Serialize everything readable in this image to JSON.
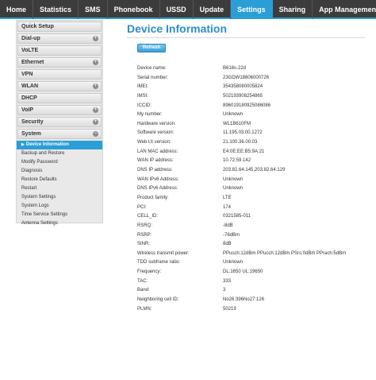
{
  "nav": {
    "tabs": [
      {
        "label": "Home"
      },
      {
        "label": "Statistics"
      },
      {
        "label": "SMS"
      },
      {
        "label": "Phonebook"
      },
      {
        "label": "USSD"
      },
      {
        "label": "Update"
      },
      {
        "label": "Settings",
        "active": true
      },
      {
        "label": "Sharing"
      },
      {
        "label": "App Management"
      }
    ]
  },
  "sidebar": {
    "items": [
      {
        "label": "Quick Setup"
      },
      {
        "label": "Dial-up"
      },
      {
        "label": "VoLTE"
      },
      {
        "label": "Ethernet"
      },
      {
        "label": "VPN"
      },
      {
        "label": "WLAN"
      },
      {
        "label": "DHCP"
      },
      {
        "label": "VoIP"
      },
      {
        "label": "Security"
      },
      {
        "label": "System"
      }
    ],
    "system_subitems": [
      {
        "label": "Device Information",
        "active": true
      },
      {
        "label": "Backup and Restore"
      },
      {
        "label": "Modify Password"
      },
      {
        "label": "Diagnosis"
      },
      {
        "label": "Restore Defaults"
      },
      {
        "label": "Restart"
      },
      {
        "label": "System Settings"
      },
      {
        "label": "System Logs"
      },
      {
        "label": "Time Service Settings"
      },
      {
        "label": "Antenna Settings"
      }
    ]
  },
  "main": {
    "title": "Device Information",
    "refresh_label": "Refresh",
    "rows": [
      {
        "label": "Device name:",
        "value": "B618s-22d"
      },
      {
        "label": "Serial number:",
        "value": "23GDW18806000726"
      },
      {
        "label": "IMEI:",
        "value": "354358080005824"
      },
      {
        "label": "IMSI:",
        "value": "502193908254865"
      },
      {
        "label": "ICCID:",
        "value": "896019180925086086"
      },
      {
        "label": "My number:",
        "value": "Unknown"
      },
      {
        "label": "Hardware version:",
        "value": "WL1B610FM"
      },
      {
        "label": "Software version:",
        "value": "11.195.03.00.1272"
      },
      {
        "label": "Web UI version:",
        "value": "21.100.36.00.03"
      },
      {
        "label": "LAN MAC address:",
        "value": "E4:0E:EE:B5:9A:21"
      },
      {
        "label": "WAN IP address:",
        "value": "10.72.59.142"
      },
      {
        "label": "DNS IP address:",
        "value": "203.82.64.145,203.82.64.129"
      },
      {
        "label": "WAN IPv6 Address:",
        "value": "Unknown"
      },
      {
        "label": "DNS IPv6 Address:",
        "value": "Unknown"
      },
      {
        "label": "Product family:",
        "value": "LTE"
      },
      {
        "label": "PCI:",
        "value": "174"
      },
      {
        "label": "CELL_ID:",
        "value": "0321585-011"
      },
      {
        "label": "RSRQ:",
        "value": "-8dB"
      },
      {
        "label": "RSRP:",
        "value": "-76dBm"
      },
      {
        "label": "SINR:",
        "value": "8dB"
      },
      {
        "label": "Wireless transmit power:",
        "value": "PPusch:12dBm PPucch:12dBm PSrs:0dBm PPrach:5dBm"
      },
      {
        "label": "TDD subframe ratio:",
        "value": "Unknown"
      },
      {
        "label": "Frequency:",
        "value": "DL:1650 UL:19650"
      },
      {
        "label": "TAC:",
        "value": "333"
      },
      {
        "label": "Band:",
        "value": "3"
      },
      {
        "label": "Neighboring cell ID:",
        "value": "No26:396No27:126"
      },
      {
        "label": "PLMN:",
        "value": "50219"
      }
    ]
  },
  "colors": {
    "accent": "#2a9ed6",
    "nav_bg": "#3c3c3c",
    "title": "#2a8fc9"
  }
}
